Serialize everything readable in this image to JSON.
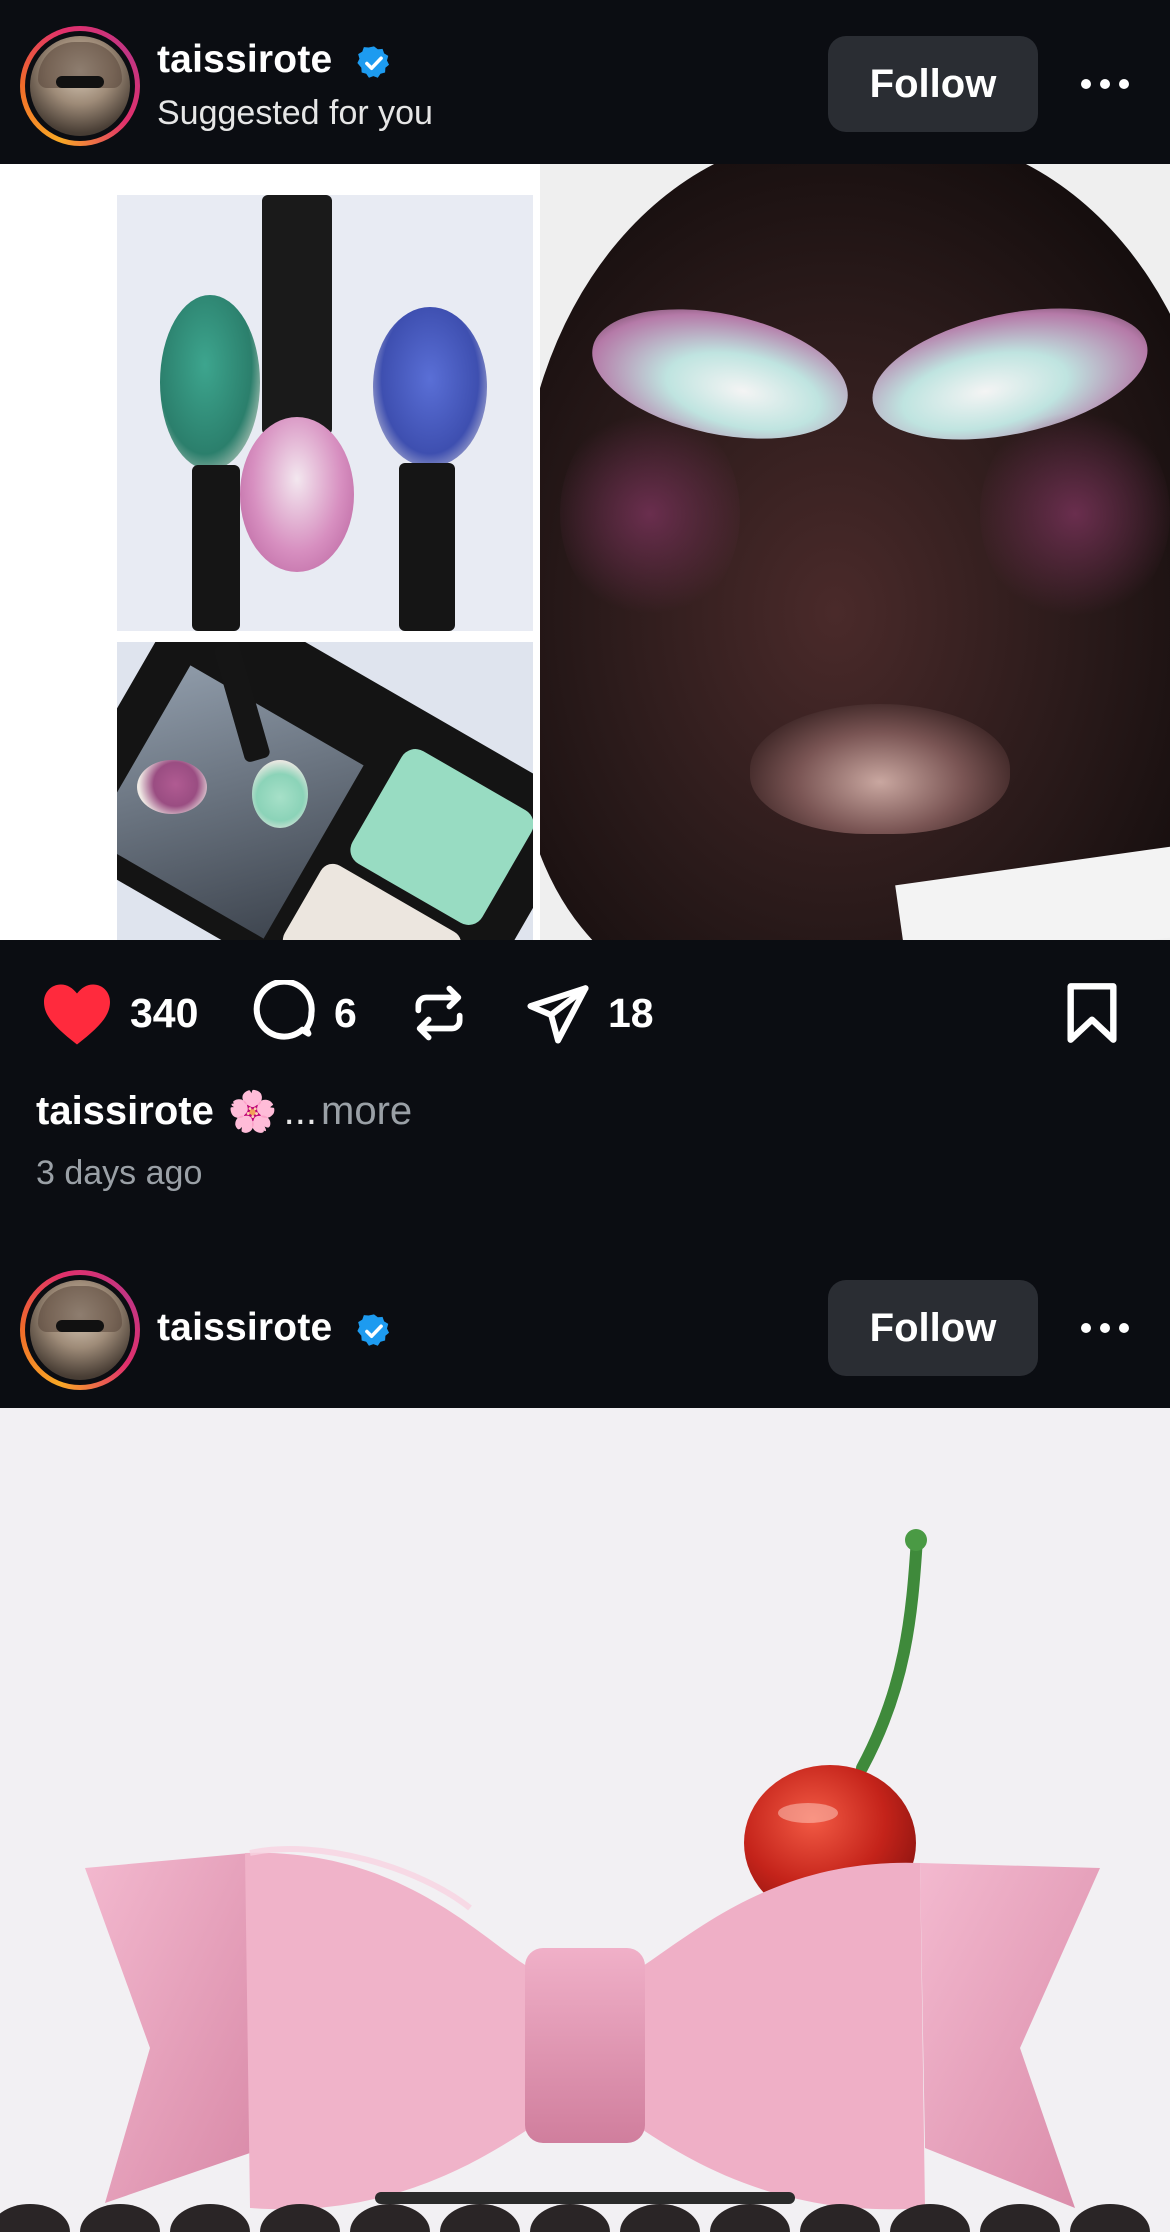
{
  "posts": [
    {
      "username": "taissirote",
      "verified": true,
      "subtitle": "Suggested for you",
      "follow_label": "Follow",
      "likes": "340",
      "comments": "6",
      "shares": "18",
      "caption_user": "taissirote",
      "caption_emoji": "🌸",
      "caption_ellipsis": "...",
      "more_label": "more",
      "timestamp": "3 days ago"
    },
    {
      "username": "taissirote",
      "verified": true,
      "follow_label": "Follow"
    }
  ],
  "colors": {
    "background": "#0b0d12",
    "like_active": "#ff2a3d",
    "verified": "#1d9bf0",
    "follow_button": "#2a2d33",
    "secondary_text": "#9aa0a6"
  },
  "icons": [
    "heart-icon",
    "comment-icon",
    "repost-icon",
    "send-icon",
    "bookmark-icon",
    "more-icon",
    "verified-badge-icon"
  ]
}
